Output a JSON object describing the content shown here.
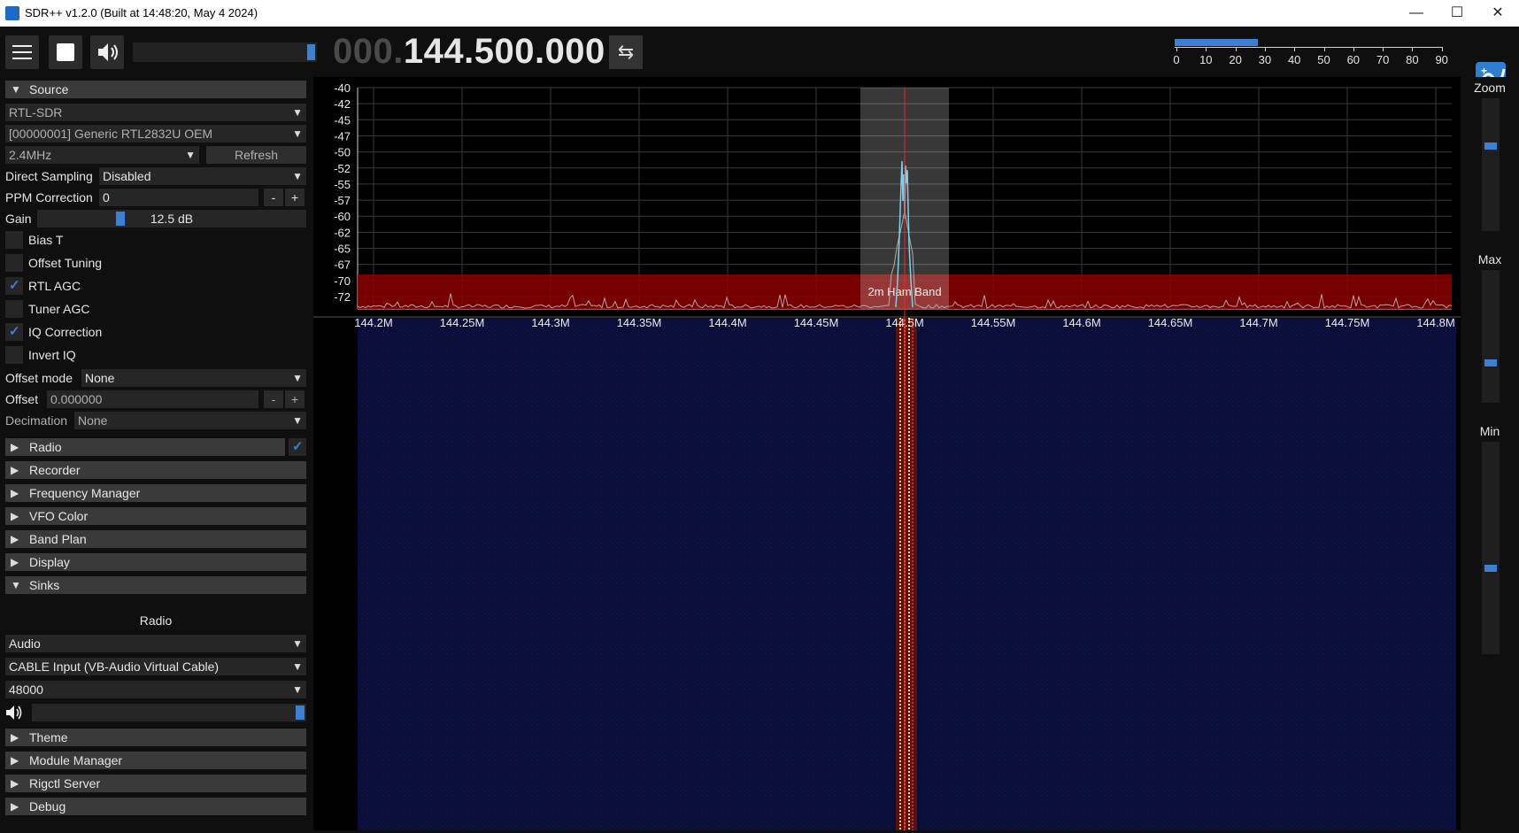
{
  "window": {
    "title": "SDR++ v1.2.0 (Built at 14:48:20, May  4 2024)",
    "minimize": "—",
    "maximize": "☐",
    "close": "✕"
  },
  "toolbar": {
    "frequency_prefix": "000.",
    "frequency_main": "144.500.000",
    "swap_symbol": "⇆",
    "snr_fill_fraction": 0.31,
    "snr_scale": [
      "0",
      "10",
      "20",
      "30",
      "40",
      "50",
      "60",
      "70",
      "80",
      "90"
    ]
  },
  "source": {
    "header": "Source",
    "type": "RTL-SDR",
    "device": "[00000001] Generic RTL2832U OEM",
    "samplerate": "2.4MHz",
    "refresh": "Refresh",
    "direct_sampling_label": "Direct Sampling",
    "direct_sampling_value": "Disabled",
    "ppm_label": "PPM Correction",
    "ppm_value": "0",
    "minus": "-",
    "plus": "+",
    "gain_label": "Gain",
    "gain_value": "12.5 dB",
    "gain_fraction": 0.3,
    "bias_t": "Bias T",
    "offset_tuning": "Offset Tuning",
    "rtl_agc": "RTL AGC",
    "tuner_agc": "Tuner AGC",
    "iq_correction": "IQ Correction",
    "invert_iq": "Invert IQ",
    "offset_mode_label": "Offset mode",
    "offset_mode_value": "None",
    "offset_label": "Offset",
    "offset_value": "0.000000",
    "decimation_label": "Decimation",
    "decimation_value": "None",
    "checkmark": "✓"
  },
  "sections": {
    "radio": "Radio",
    "recorder": "Recorder",
    "frequency_manager": "Frequency Manager",
    "vfo_color": "VFO Color",
    "band_plan": "Band Plan",
    "display": "Display",
    "sinks": "Sinks",
    "theme": "Theme",
    "module_manager": "Module Manager",
    "rigctl_server": "Rigctl Server",
    "debug": "Debug"
  },
  "sinks": {
    "stream_name": "Radio",
    "sink_type": "Audio",
    "device": "CABLE Input (VB-Audio Virtual Cable)",
    "samplerate": "48000",
    "volume_fraction": 1.0
  },
  "fft": {
    "y_labels": [
      "-40",
      "-42",
      "-45",
      "-47",
      "-50",
      "-52",
      "-55",
      "-57",
      "-60",
      "-62",
      "-65",
      "-67",
      "-70",
      "-72"
    ],
    "x_labels": [
      "144.2M",
      "144.25M",
      "144.3M",
      "144.35M",
      "144.4M",
      "144.45M",
      "144.5M",
      "144.55M",
      "144.6M",
      "144.65M",
      "144.7M",
      "144.75M",
      "144.8M"
    ],
    "band_label": "2m Ham Band",
    "band_color": "#8b0000",
    "vfo_color": "#ff2020",
    "trace_color": "#7ad3ea"
  },
  "side": {
    "zoom": "Zoom",
    "max": "Max",
    "min": "Min",
    "zoom_fraction": 0.35,
    "max_fraction": 0.72,
    "min_fraction": 0.6
  },
  "colors": {
    "accent": "#3c80d6",
    "waterfall_bg": "#0a0f3a"
  }
}
